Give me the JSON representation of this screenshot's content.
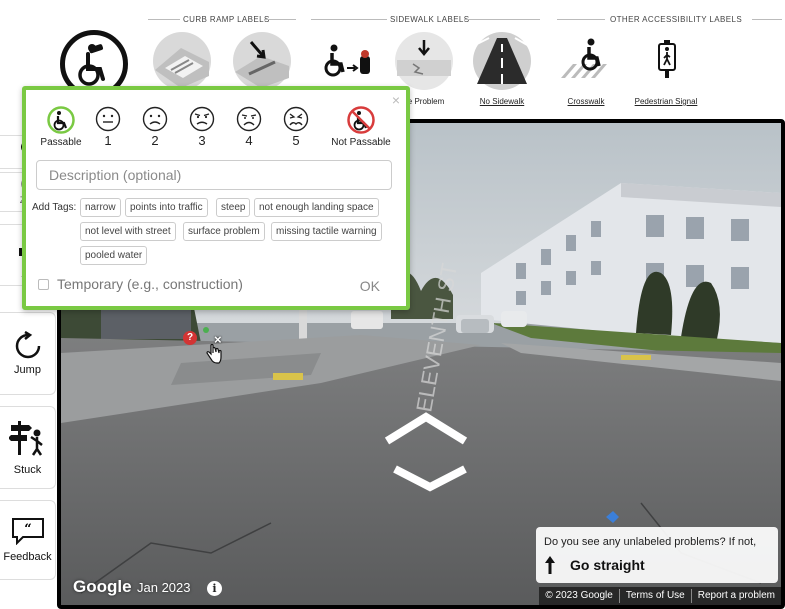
{
  "toolbar": {
    "groups": [
      {
        "title": "CURB RAMP LABELS"
      },
      {
        "title": "SIDEWALK LABELS"
      },
      {
        "title": "OTHER ACCESSIBILITY LABELS"
      }
    ],
    "tools": [
      {
        "name": "walk-mode",
        "label": "",
        "icon": "wheelchair-explore-icon"
      },
      {
        "name": "curb-ramp",
        "label": "",
        "icon": "curb-ramp-icon"
      },
      {
        "name": "missing-curb-ramp",
        "label": "",
        "icon": "missing-curb-ramp-icon"
      },
      {
        "name": "obstacle",
        "label": "",
        "icon": "obstacle-icon"
      },
      {
        "name": "surface-problem",
        "label": "ce Problem",
        "icon": "surface-problem-icon"
      },
      {
        "name": "no-sidewalk",
        "label": "No Sidewalk",
        "icon": "no-sidewalk-icon"
      },
      {
        "name": "crosswalk",
        "label": "Crosswalk",
        "icon": "crosswalk-icon"
      },
      {
        "name": "pedestrian-signal",
        "label": "Pedestrian Signal",
        "icon": "pedestrian-signal-icon"
      }
    ],
    "selected": "walk-mode"
  },
  "sidebar": {
    "items": [
      {
        "label": "Zo",
        "icon": "zoom-in-icon"
      },
      {
        "label": "Zoo",
        "icon": "zoom-out-icon"
      },
      {
        "label": "Sc",
        "icon": "sound-icon"
      },
      {
        "label": "Jump",
        "icon": "jump-icon"
      },
      {
        "label": "Stuck",
        "icon": "stuck-icon"
      },
      {
        "label": "Feedback",
        "icon": "feedback-icon"
      }
    ]
  },
  "popup": {
    "severity": [
      {
        "num": "",
        "word": "Passable",
        "icon": "passable-icon"
      },
      {
        "num": "1",
        "word": "",
        "icon": "severity-1-icon"
      },
      {
        "num": "2",
        "word": "",
        "icon": "severity-2-icon"
      },
      {
        "num": "3",
        "word": "",
        "icon": "severity-3-icon"
      },
      {
        "num": "4",
        "word": "",
        "icon": "severity-4-icon"
      },
      {
        "num": "5",
        "word": "",
        "icon": "severity-5-icon"
      },
      {
        "num": "",
        "word": "Not Passable",
        "icon": "not-passable-icon"
      }
    ],
    "description_placeholder": "Description (optional)",
    "tags_title": "Add Tags:",
    "tags": [
      "narrow",
      "points into traffic",
      "steep",
      "not enough landing space",
      "not level with street",
      "surface problem",
      "missing tactile warning",
      "pooled water"
    ],
    "temporary_label": "Temporary (e.g., construction)",
    "ok_label": "OK",
    "close_glyph": "×",
    "accent_color": "#7ac943"
  },
  "streetview": {
    "logo": "Google",
    "date": "Jan 2023",
    "info_glyph": "i",
    "prompt_question": "Do you see any unlabeled problems? If not,",
    "prompt_action": "Go straight",
    "footer": [
      "© 2023 Google",
      "Terms of Use",
      "Report a problem"
    ],
    "marker_glyph": "?",
    "marker_close": "×"
  }
}
